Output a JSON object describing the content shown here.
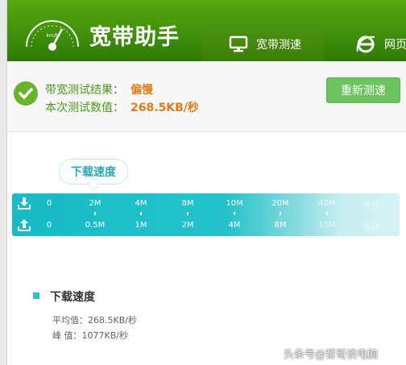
{
  "header": {
    "app_title": "宽带助手",
    "tabs": [
      {
        "label": "宽带测速",
        "icon": "monitor-icon",
        "active": true
      },
      {
        "label": "网页",
        "icon": "ie-browser-icon",
        "active": false
      }
    ],
    "colors": {
      "header": "#3e8e0b",
      "accent": "#6ab42c"
    }
  },
  "result": {
    "result_label": "带宽测试结果：",
    "result_value": "偏慢",
    "value_label": "本次测试数值：",
    "value": "268.5KB/秒",
    "retest_label": "重新测速"
  },
  "speedbar": {
    "bubble_label": "下载速度",
    "download_ticks": [
      "0",
      "2M",
      "4M",
      "8M",
      "10M",
      "20M",
      "40M",
      "专线"
    ],
    "upload_ticks": [
      "0",
      "0.5M",
      "1M",
      "2M",
      "4M",
      "8M",
      "10M",
      "专线"
    ],
    "color": "#22c1ca"
  },
  "stats": {
    "title": "下载速度",
    "avg_label": "平均值：",
    "avg_value": "268.5KB/秒",
    "peak_label": "峰  值：",
    "peak_value": "1077KB/秒"
  },
  "watermark": "头条号@哲哥谈电脑"
}
